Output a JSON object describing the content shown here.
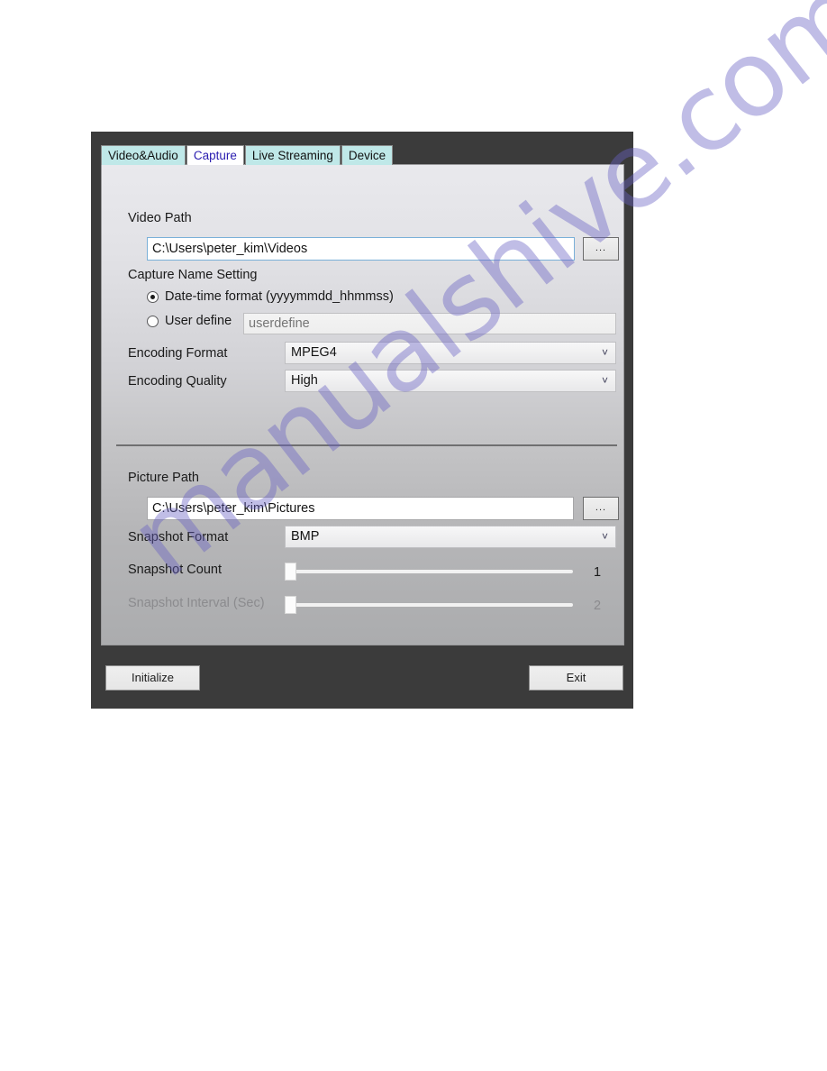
{
  "dialog": {
    "tabs": [
      {
        "label": "Video&Audio",
        "active": false
      },
      {
        "label": "Capture",
        "active": true
      },
      {
        "label": "Live Streaming",
        "active": false
      },
      {
        "label": "Device",
        "active": false
      }
    ],
    "video_section": {
      "video_path_label": "Video Path",
      "video_path_value": "C:\\Users\\peter_kim\\Videos",
      "browse_label": "...",
      "capture_name_label": "Capture Name Setting",
      "radio_datetime_label": "Date-time format (yyyymmdd_hhmmss)",
      "radio_userdefine_label": "User define",
      "userdefine_placeholder": "userdefine",
      "encoding_format_label": "Encoding Format",
      "encoding_format_value": "MPEG4",
      "encoding_quality_label": "Encoding Quality",
      "encoding_quality_value": "High",
      "chevron": "˅"
    },
    "picture_section": {
      "picture_path_label": "Picture Path",
      "picture_path_value": "C:\\Users\\peter_kim\\Pictures",
      "browse_label": "...",
      "snapshot_format_label": "Snapshot Format",
      "snapshot_format_value": "BMP",
      "snapshot_count_label": "Snapshot Count",
      "snapshot_count_value": "1",
      "snapshot_interval_label": "Snapshot Interval (Sec)",
      "snapshot_interval_value": "2",
      "chevron": "˅"
    },
    "footer": {
      "initialize_label": "Initialize",
      "exit_label": "Exit"
    }
  },
  "watermark": {
    "text": "manualshive.com"
  },
  "colors": {
    "tab_inactive_bg": "#bfe8e8",
    "tab_active_text": "#2a1db0",
    "window_frame": "#3b3b3b",
    "focus_border": "#7ab0d8",
    "watermark": "#6862c4"
  }
}
